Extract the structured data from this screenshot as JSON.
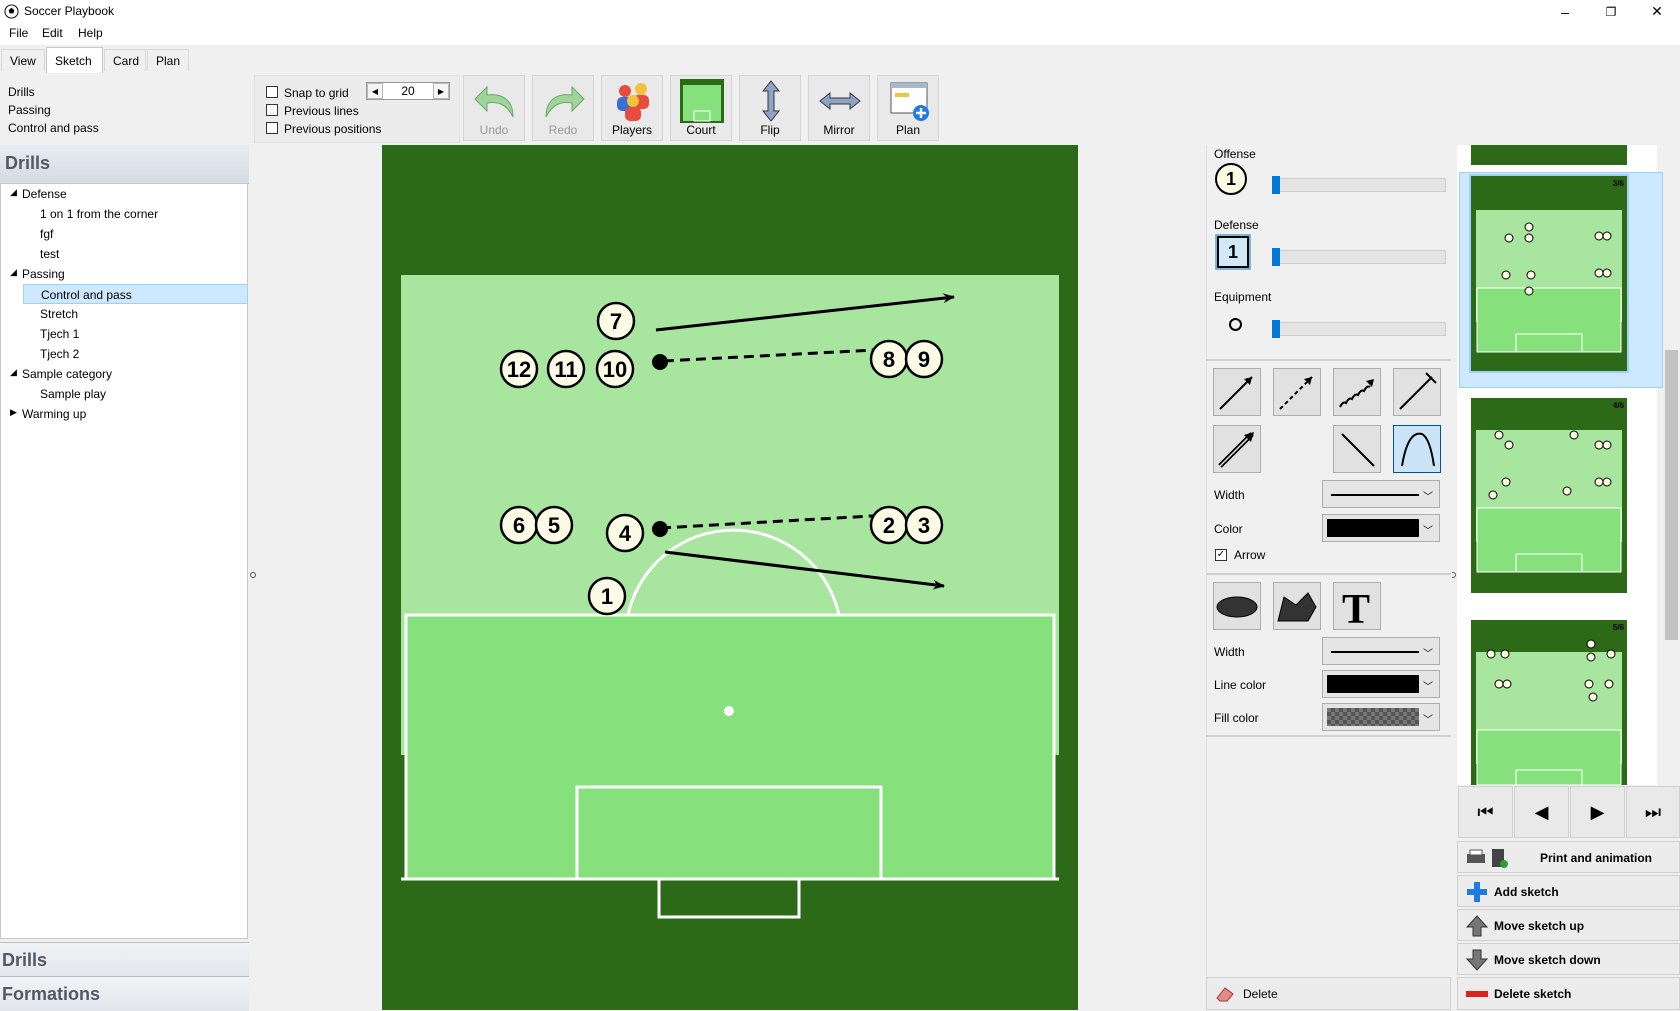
{
  "window": {
    "title": "Soccer Playbook",
    "min": "–",
    "restore": "❐",
    "close": "✕"
  },
  "menu": [
    "File",
    "Edit",
    "Help"
  ],
  "tabs": [
    "View",
    "Sketch",
    "Card",
    "Plan"
  ],
  "active_tab": "Sketch",
  "breadcrumb": [
    "Drills",
    "Passing",
    "Control and pass"
  ],
  "grid": {
    "snap_label": "Snap to grid",
    "prev_lines_label": "Previous lines",
    "prev_positions_label": "Previous positions",
    "grid_value": "20"
  },
  "toolbar": {
    "undo": "Undo",
    "redo": "Redo",
    "players": "Players",
    "court": "Court",
    "flip": "Flip",
    "mirror": "Mirror",
    "plan": "Plan"
  },
  "left": {
    "header": "Drills",
    "tree": [
      {
        "label": "Defense",
        "level": 0,
        "expanded": true
      },
      {
        "label": "1 on 1 from the corner",
        "level": 1
      },
      {
        "label": "fgf",
        "level": 1
      },
      {
        "label": "test",
        "level": 1
      },
      {
        "label": "Passing",
        "level": 0,
        "expanded": true
      },
      {
        "label": "Control and pass",
        "level": 1,
        "selected": true
      },
      {
        "label": "Stretch",
        "level": 1
      },
      {
        "label": "Tjech 1",
        "level": 1
      },
      {
        "label": "Tjech 2",
        "level": 1
      },
      {
        "label": "Sample category",
        "level": 0,
        "expanded": true
      },
      {
        "label": "Sample play",
        "level": 1
      },
      {
        "label": "Warming up",
        "level": 0,
        "expanded": false
      }
    ],
    "footer_drills": "Drills",
    "footer_formations": "Formations"
  },
  "field": {
    "players": [
      "7",
      "10",
      "11",
      "12",
      "8",
      "9",
      "6",
      "5",
      "4",
      "2",
      "3",
      "1"
    ],
    "colors": {
      "grass_dark": "#2d6a17",
      "grass_light": "#a8e6a0",
      "grass_mid": "#86e07c"
    }
  },
  "props": {
    "offense_label": "Offense",
    "offense_sample": "1",
    "defense_label": "Defense",
    "defense_sample": "1",
    "equipment_label": "Equipment",
    "width_label": "Width",
    "color_label": "Color",
    "arrow_label": "Arrow",
    "width2_label": "Width",
    "line_color_label": "Line color",
    "fill_color_label": "Fill color",
    "delete": "Delete"
  },
  "thumbnails": [
    {
      "label": "3/6"
    },
    {
      "label": "4/6"
    },
    {
      "label": "5/6"
    }
  ],
  "side_actions": {
    "print": "Print and animation",
    "add": "Add sketch",
    "up": "Move sketch up",
    "down": "Move sketch down",
    "delete": "Delete sketch"
  }
}
